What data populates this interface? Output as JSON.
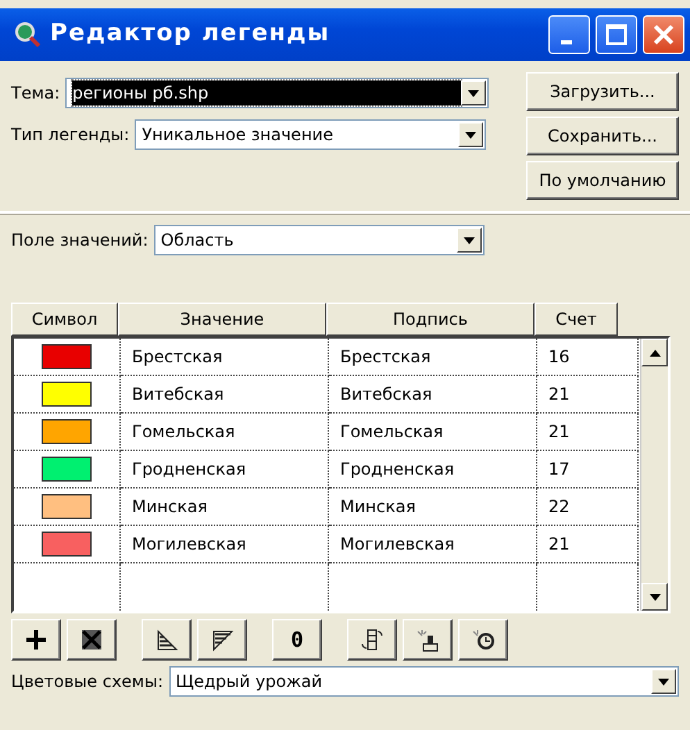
{
  "window": {
    "title": "Редактор легенды",
    "controls": [
      {
        "kind": "minimize"
      },
      {
        "kind": "maximize"
      },
      {
        "kind": "close"
      }
    ]
  },
  "theme": {
    "label": "Тема:",
    "value": "регионы рб.shp",
    "focused": true
  },
  "legend_type": {
    "label": "Тип легенды:",
    "value": "Уникальное значение",
    "focused": false
  },
  "buttons": [
    "Загрузить...",
    "Сохранить...",
    "По умолчанию"
  ],
  "value_field": {
    "label": "Поле значений:",
    "value": "Область"
  },
  "table": {
    "columns": [
      "Символ",
      "Значение",
      "Подпись",
      "Счет"
    ],
    "rows": [
      {
        "color": "#e80000",
        "value": "Брестская",
        "label": "Брестская",
        "count": "16"
      },
      {
        "color": "#ffff00",
        "value": "Витебская",
        "label": "Витебская",
        "count": "21"
      },
      {
        "color": "#ffa500",
        "value": "Гомельская",
        "label": "Гомельская",
        "count": "21"
      },
      {
        "color": "#00f070",
        "value": "Гродненская",
        "label": "Гродненская",
        "count": "17"
      },
      {
        "color": "#ffbf80",
        "value": "Минская",
        "label": "Минская",
        "count": "22"
      },
      {
        "color": "#f86060",
        "value": "Могилевская",
        "label": "Могилевская",
        "count": "21"
      }
    ]
  },
  "toolbar": [
    {
      "kind": "add"
    },
    {
      "kind": "delete"
    },
    {
      "kind": "sort-asc"
    },
    {
      "kind": "sort-desc"
    },
    {
      "kind": "zero",
      "text": "0"
    },
    {
      "kind": "reverse"
    },
    {
      "kind": "symbol"
    },
    {
      "kind": "reset"
    }
  ],
  "color_schemes": {
    "label": "Цветовые схемы:",
    "value": "Щедрый урожай"
  }
}
